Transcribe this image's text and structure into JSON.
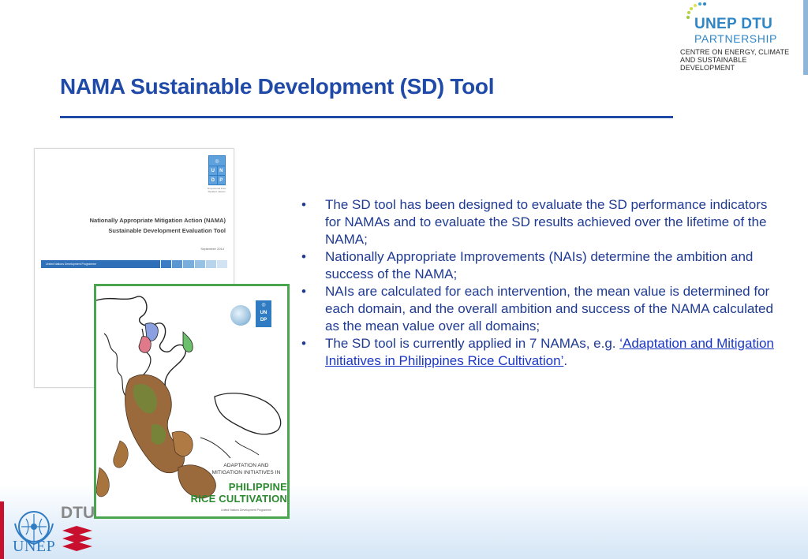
{
  "header": {
    "partner_line1": "UNEP DTU",
    "partner_line2": "PARTNERSHIP",
    "partner_line3": "CENTRE ON ENERGY, CLIMATE",
    "partner_line4": "AND SUSTAINABLE DEVELOPMENT"
  },
  "slide": {
    "title": "NAMA Sustainable Development (SD) Tool"
  },
  "cover1": {
    "undp_letters": [
      "U",
      "N",
      "D",
      "P"
    ],
    "undp_caption": "Empowered lives. Resilient nations.",
    "title_line1": "Nationally Appropriate Mitigation Action (NAMA)",
    "title_line2": "Sustainable Development Evaluation Tool",
    "date": "September 2014",
    "bar_text": "United Nations Development Programme"
  },
  "cover2": {
    "title_line1": "ADAPTATION AND",
    "title_line2": "MITIGATION INITIATIVES IN",
    "title_line3": "PHILIPPINE",
    "title_line4": "RICE CULTIVATION",
    "footer": "United Nations Development Programme"
  },
  "bullets": [
    {
      "text": "The SD tool has been designed to evaluate the SD performance indicators for NAMAs and to evaluate the SD results achieved over the lifetime of the NAMA;"
    },
    {
      "text": "Nationally Appropriate Improvements (NAIs) determine the ambition and success of the NAMA;"
    },
    {
      "text": "NAIs are calculated for each intervention, the mean value is determined for each domain, and the overall ambition and success of the NAMA calculated as the mean value over all domains;"
    },
    {
      "text_before": "The SD tool is currently applied in 7 NAMAs, e.g. ",
      "link_text": "‘Adaptation and Mitigation Initiatives in Philippines Rice Cultivation’",
      "text_after": "."
    }
  ],
  "footer_logos": {
    "unep_text": "UNEP",
    "dtu_text": "DTU"
  },
  "colors": {
    "title_blue": "#1f4aa8",
    "bullet_blue": "#1f3a93",
    "link_blue": "#1a36c4",
    "partner_blue": "#2f86c6",
    "rice_green": "#2a8a2e",
    "dtu_red": "#c8102e"
  }
}
